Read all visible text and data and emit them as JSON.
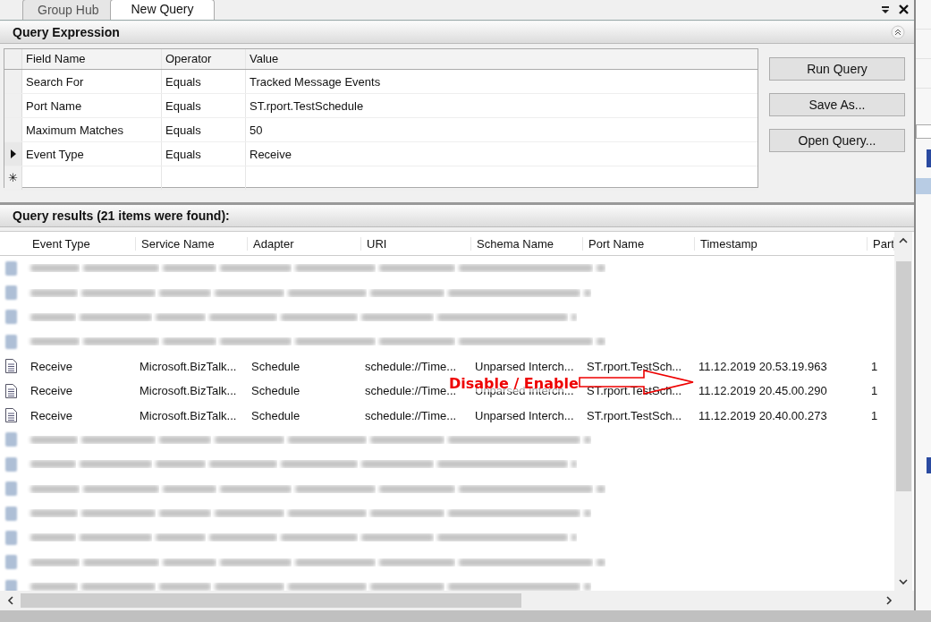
{
  "tabs": [
    {
      "label": "Group Hub",
      "selected": false
    },
    {
      "label": "New Query",
      "selected": true
    }
  ],
  "query_expression": {
    "title": "Query Expression",
    "columns": [
      "Field Name",
      "Operator",
      "Value"
    ],
    "rows": [
      {
        "field": "Search For",
        "operator": "Equals",
        "value": "Tracked Message Events",
        "current": false
      },
      {
        "field": "Port Name",
        "operator": "Equals",
        "value": "ST.rport.TestSchedule",
        "current": false
      },
      {
        "field": "Maximum Matches",
        "operator": "Equals",
        "value": "50",
        "current": false
      },
      {
        "field": "Event Type",
        "operator": "Equals",
        "value": "Receive",
        "current": true
      }
    ],
    "new_row_marker": "✳"
  },
  "buttons": [
    "Run Query",
    "Save As...",
    "Open Query..."
  ],
  "results": {
    "title": "Query results (21 items were found):",
    "columns": [
      "Event Type",
      "Service Name",
      "Adapter",
      "URI",
      "Schema Name",
      "Port Name",
      "Timestamp",
      "Part"
    ],
    "rows": [
      {
        "kind": "redacted"
      },
      {
        "kind": "redacted"
      },
      {
        "kind": "redacted"
      },
      {
        "kind": "redacted"
      },
      {
        "kind": "message",
        "cells": [
          "Receive",
          "Microsoft.BizTalk...",
          "Schedule",
          "schedule://Time...",
          "Unparsed Interch...",
          "ST.rport.TestSch...",
          "11.12.2019 20.53.19.963",
          "1"
        ]
      },
      {
        "kind": "message",
        "cells": [
          "Receive",
          "Microsoft.BizTalk...",
          "Schedule",
          "schedule://Time...",
          "Unparsed Interch...",
          "ST.rport.TestSch...",
          "11.12.2019 20.45.00.290",
          "1"
        ]
      },
      {
        "kind": "message",
        "cells": [
          "Receive",
          "Microsoft.BizTalk...",
          "Schedule",
          "schedule://Time...",
          "Unparsed Interch...",
          "ST.rport.TestSch...",
          "11.12.2019 20.40.00.273",
          "1"
        ]
      },
      {
        "kind": "redacted"
      },
      {
        "kind": "redacted"
      },
      {
        "kind": "redacted"
      },
      {
        "kind": "redacted"
      },
      {
        "kind": "redacted"
      },
      {
        "kind": "redacted"
      },
      {
        "kind": "redacted"
      }
    ]
  },
  "annotation": {
    "label": "Disable / Enable"
  }
}
